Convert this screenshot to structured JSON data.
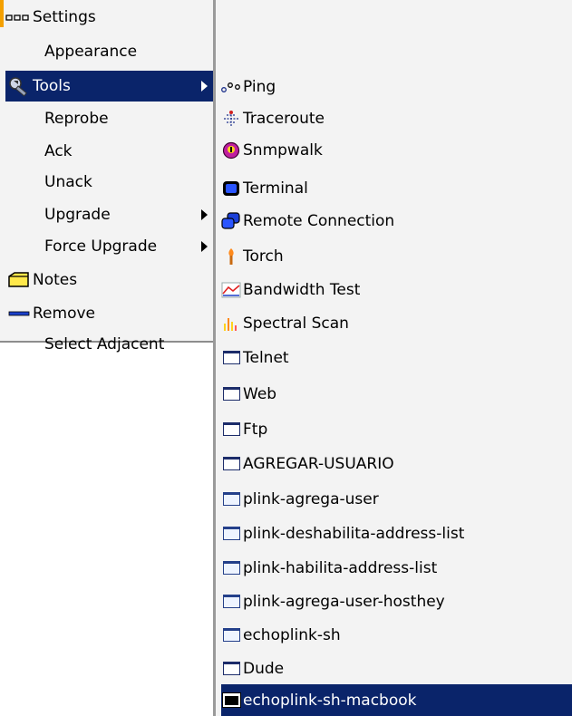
{
  "main_menu": {
    "items": [
      {
        "label": "Settings",
        "icon": "settings-dots-icon"
      },
      {
        "label": "Appearance"
      },
      {
        "label": "Tools",
        "icon": "tools-icon",
        "submenu": true,
        "selected": true
      },
      {
        "label": "Reprobe"
      },
      {
        "label": "Ack"
      },
      {
        "label": "Unack"
      },
      {
        "label": "Upgrade",
        "submenu": true
      },
      {
        "label": "Force Upgrade",
        "submenu": true
      },
      {
        "label": "Notes",
        "icon": "notes-icon"
      },
      {
        "label": "Remove",
        "icon": "remove-icon"
      },
      {
        "label": "Select Adjacent"
      }
    ]
  },
  "tools_menu": {
    "items": [
      {
        "label": "Ping",
        "icon": "ping-icon"
      },
      {
        "label": "Traceroute",
        "icon": "traceroute-icon"
      },
      {
        "label": "Snmpwalk",
        "icon": "snmpwalk-icon"
      },
      {
        "label": "Terminal",
        "icon": "terminal-icon"
      },
      {
        "label": "Remote Connection",
        "icon": "remote-connection-icon"
      },
      {
        "label": "Torch",
        "icon": "torch-icon"
      },
      {
        "label": "Bandwidth Test",
        "icon": "bandwidth-test-icon"
      },
      {
        "label": "Spectral Scan",
        "icon": "spectral-scan-icon"
      },
      {
        "label": "Telnet",
        "icon": "window-icon"
      },
      {
        "label": "Web",
        "icon": "window-icon"
      },
      {
        "label": "Ftp",
        "icon": "window-icon"
      },
      {
        "label": "AGREGAR-USUARIO",
        "icon": "window-icon"
      },
      {
        "label": "plink-agrega-user",
        "icon": "window-icon"
      },
      {
        "label": "plink-deshabilita-address-list",
        "icon": "window-icon"
      },
      {
        "label": "plink-habilita-address-list",
        "icon": "window-icon"
      },
      {
        "label": "plink-agrega-user-hosthey",
        "icon": "window-icon"
      },
      {
        "label": "echoplink-sh",
        "icon": "window-icon"
      },
      {
        "label": "Dude",
        "icon": "window-icon"
      },
      {
        "label": "echoplink-sh-macbook",
        "icon": "terminal-window-icon",
        "selected": true
      }
    ]
  },
  "colors": {
    "menu_bg": "#f3f3f3",
    "selection_bg": "#0a246a",
    "selection_text": "#ffffff",
    "accent_orange": "#f4a000"
  }
}
